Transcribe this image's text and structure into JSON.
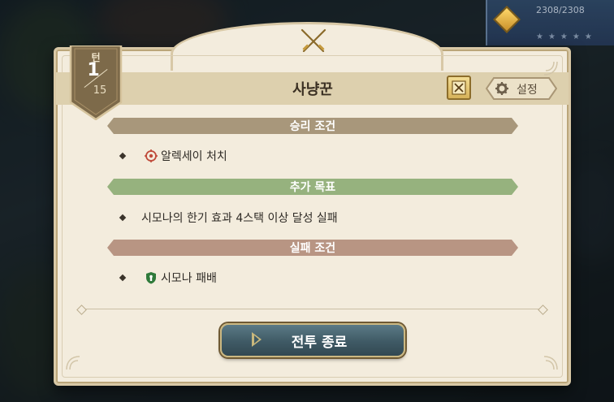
{
  "hud": {
    "hp_text": "2308/2308",
    "stars": "★★★★★"
  },
  "turn": {
    "label": "턴",
    "current": "1",
    "total": "15"
  },
  "dialog": {
    "title": "사냥꾼",
    "settings_label": "설정"
  },
  "sections": {
    "victory": {
      "header": "승리 조건",
      "item": "알렉세이 처치",
      "icon": "target-icon"
    },
    "extra": {
      "header": "추가 목표",
      "item": "시모나의 한기 효과 4스택 이상 달성 실패"
    },
    "defeat": {
      "header": "실패 조건",
      "item": "시모나 패배",
      "icon": "shield-icon"
    }
  },
  "end_button": {
    "label": "전투 종료"
  },
  "colors": {
    "dialog_bg": "#f3ecdd",
    "victory_header": "#a8977b",
    "extra_header": "#96b27e",
    "defeat_header": "#b89583",
    "button": "#3f5a65"
  }
}
